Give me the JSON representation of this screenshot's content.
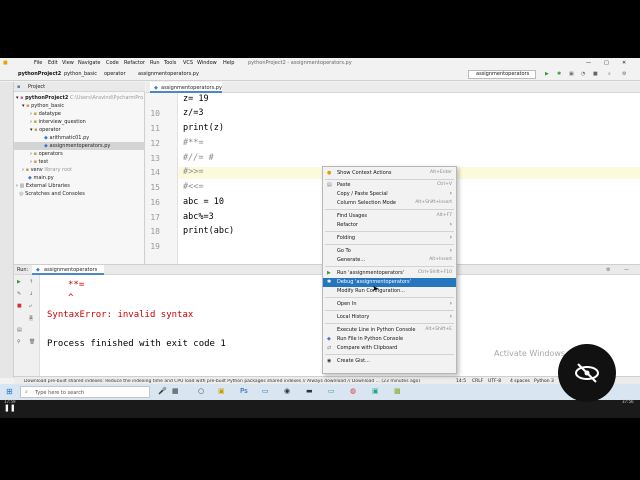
{
  "window_title": "pythonProject2 - assignmentoperators.py",
  "menu": [
    "File",
    "Edit",
    "View",
    "Navigate",
    "Code",
    "Refactor",
    "Run",
    "Tools",
    "VCS",
    "Window",
    "Help"
  ],
  "breadcrumbs": [
    "pythonProject2",
    "python_basic",
    "operator",
    "assignmentoperators.py"
  ],
  "run_config": "assignmentoperators",
  "project_panel": {
    "title": "Project",
    "tree": [
      {
        "label": "pythonProject2",
        "extra": "C:\\Users\\Aravind\\PycharmPro"
      },
      {
        "label": "python_basic"
      },
      {
        "label": "datatype"
      },
      {
        "label": "interview_question"
      },
      {
        "label": "operator"
      },
      {
        "label": "arithmatic01.py"
      },
      {
        "label": "assignmentoperators.py"
      },
      {
        "label": "operators"
      },
      {
        "label": "test"
      },
      {
        "label": "venv",
        "extra": "library root"
      },
      {
        "label": "main.py"
      },
      {
        "label": "External Libraries"
      },
      {
        "label": "Scratches and Consoles"
      }
    ]
  },
  "editor": {
    "tab": "assignmentoperators.py",
    "lines": [
      {
        "num": "",
        "text": "z= 19",
        "comment": false
      },
      {
        "num": "10",
        "text": "z/=3",
        "comment": false
      },
      {
        "num": "11",
        "text": "print(z)",
        "comment": false
      },
      {
        "num": "12",
        "text": "#**=",
        "comment": true
      },
      {
        "num": "13",
        "text": "#//= #",
        "comment": true
      },
      {
        "num": "14",
        "text": "#>>=",
        "comment": true
      },
      {
        "num": "15",
        "text": "#<<=",
        "comment": true
      },
      {
        "num": "16",
        "text": "abc = 10",
        "comment": false
      },
      {
        "num": "17",
        "text": "abc%=3",
        "comment": false
      },
      {
        "num": "18",
        "text": "print(abc)",
        "comment": false
      },
      {
        "num": "19",
        "text": "",
        "comment": false
      }
    ]
  },
  "run_panel": {
    "label": "Run:",
    "tab": "assignmentoperators",
    "output": [
      "**=",
      "^",
      "SyntaxError: invalid syntax",
      "Process finished with exit code 1"
    ]
  },
  "context_menu": [
    {
      "label": "Show Context Actions",
      "shortcut": "Alt+Enter"
    },
    {
      "sep": true
    },
    {
      "label": "Paste",
      "shortcut": "Ctrl+V"
    },
    {
      "label": "Copy / Paste Special",
      "arrow": true
    },
    {
      "label": "Column Selection Mode",
      "shortcut": "Alt+Shift+Insert"
    },
    {
      "sep": true
    },
    {
      "label": "Find Usages",
      "shortcut": "Alt+F7"
    },
    {
      "label": "Refactor",
      "arrow": true
    },
    {
      "sep": true
    },
    {
      "label": "Folding",
      "arrow": true
    },
    {
      "sep": true
    },
    {
      "label": "Go To",
      "arrow": true
    },
    {
      "label": "Generate...",
      "shortcut": "Alt+Insert"
    },
    {
      "sep": true
    },
    {
      "label": "Run 'assignmentoperators'",
      "shortcut": "Ctrl+Shift+F10"
    },
    {
      "label": "Debug 'assignmentoperators'",
      "selected": true
    },
    {
      "label": "Modify Run Configuration..."
    },
    {
      "sep": true
    },
    {
      "label": "Open In",
      "arrow": true
    },
    {
      "sep": true
    },
    {
      "label": "Local History",
      "arrow": true
    },
    {
      "sep": true
    },
    {
      "label": "Execute Line in Python Console",
      "shortcut": "Alt+Shift+E"
    },
    {
      "label": "Run File in Python Console"
    },
    {
      "label": "Compare with Clipboard"
    },
    {
      "sep": true
    },
    {
      "label": "Create Gist..."
    }
  ],
  "status_bar": {
    "message": "Download pre-built shared indexes: Reduce the indexing time and CPU load with pre-built Python packages shared indexes // Always download // Download ... (23 minutes ago)",
    "position": "14:5",
    "line_sep": "CRLF",
    "encoding": "UTF-8",
    "indent": "4 spaces",
    "interpreter": "Python 3"
  },
  "watermark": "Activate Windows",
  "taskbar": {
    "search_placeholder": "Type here to search",
    "time_left": "17:59",
    "time_right": "37:56"
  },
  "colors": {
    "selection": "#2675bf",
    "current_line": "#fcfadc",
    "error": "#cc0000"
  }
}
